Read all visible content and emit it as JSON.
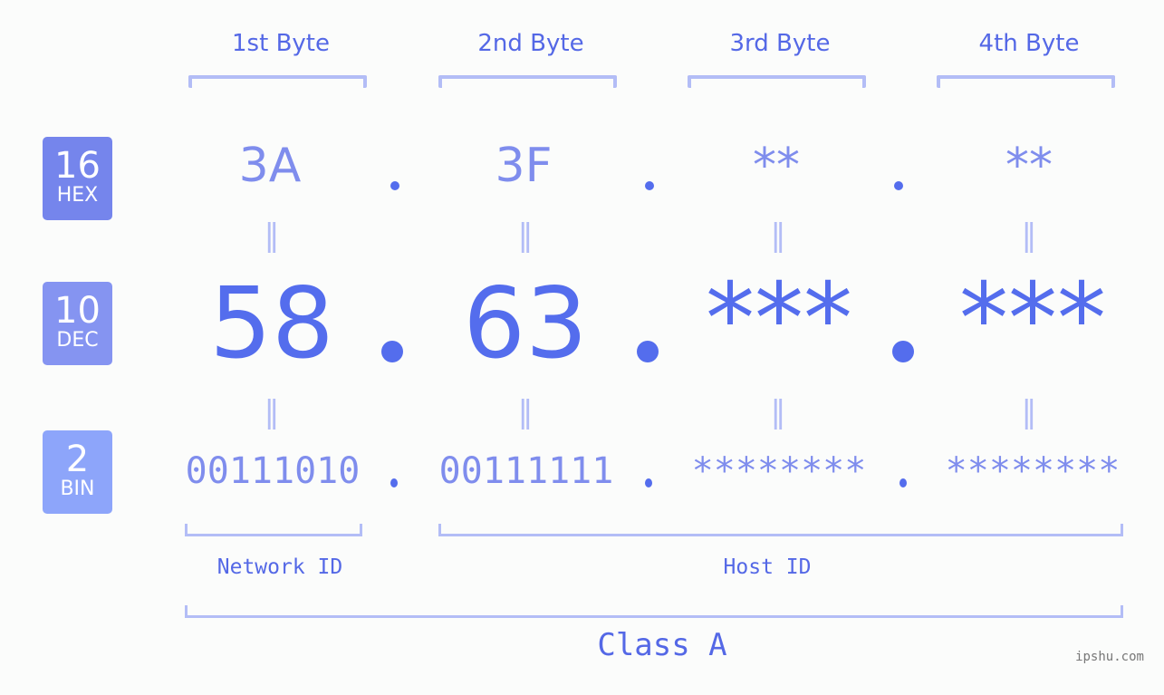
{
  "bytes": [
    {
      "header": "1st Byte",
      "hex": "3A",
      "dec": "58",
      "bin": "00111010"
    },
    {
      "header": "2nd Byte",
      "hex": "3F",
      "dec": "63",
      "bin": "00111111"
    },
    {
      "header": "3rd Byte",
      "hex": "**",
      "dec": "***",
      "bin": "********"
    },
    {
      "header": "4th Byte",
      "hex": "**",
      "dec": "***",
      "bin": "********"
    }
  ],
  "badges": {
    "hex": {
      "num": "16",
      "label": "HEX",
      "color": "#7585ec"
    },
    "dec": {
      "num": "10",
      "label": "DEC",
      "color": "#8594f1"
    },
    "bin": {
      "num": "2",
      "label": "BIN",
      "color": "#8da5fa"
    }
  },
  "equals": "=",
  "network_label": "Network ID",
  "host_label": "Host ID",
  "class_label": "Class A",
  "watermark": "ipshu.com",
  "colors": {
    "accent": "#546ded",
    "light": "#b3bdf6",
    "mid": "#7f8ded"
  }
}
